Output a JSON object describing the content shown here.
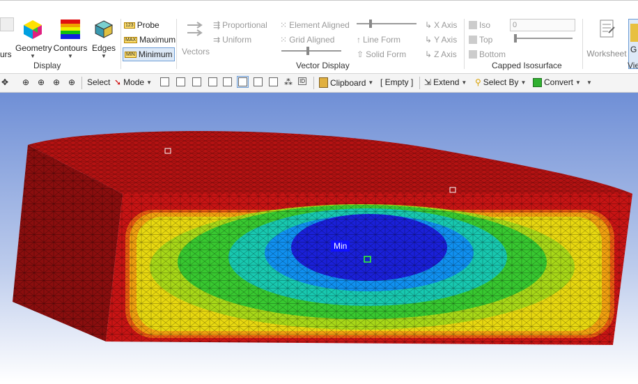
{
  "ribbon": {
    "groups": {
      "display": "Display",
      "vector_display": "Vector Display",
      "capped_isosurface": "Capped Isosurface"
    },
    "cut_label": "urs",
    "geometry": "Geometry",
    "contours": "Contours",
    "edges": "Edges",
    "probe": "Probe",
    "maximum": "Maximum",
    "minimum": "Minimum",
    "vectors": "Vectors",
    "proportional": "Proportional",
    "uniform": "Uniform",
    "element_aligned": "Element Aligned",
    "grid_aligned": "Grid Aligned",
    "line_form": "Line Form",
    "solid_form": "Solid Form",
    "x_axis": "X Axis",
    "y_axis": "Y Axis",
    "z_axis": "Z Axis",
    "iso": "Iso",
    "top": "Top",
    "bottom": "Bottom",
    "iso_value": "0",
    "worksheet": "Worksheet",
    "view_cut": "Vie",
    "g_cut": "G",
    "probe_icon_text": "123",
    "max_icon_text": "MAX",
    "min_icon_text": "MIN"
  },
  "toolbar": {
    "select": "Select",
    "mode": "Mode",
    "clipboard": "Clipboard",
    "empty": "[ Empty ]",
    "extend": "Extend",
    "select_by": "Select By",
    "convert": "Convert"
  },
  "viewport": {
    "min_label": "Min"
  },
  "colors": {
    "accent": "#6d9dd6",
    "contour_red": "#c81414",
    "contour_blue": "#0a1ae0",
    "background_top": "#6f8fd6",
    "background_bottom": "#ffffff"
  }
}
